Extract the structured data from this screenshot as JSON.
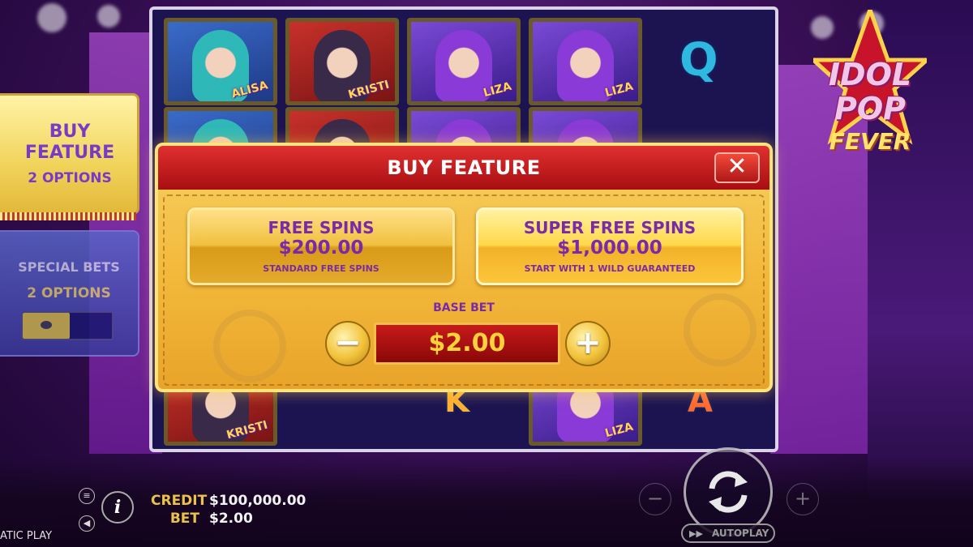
{
  "game": {
    "logo_line1": "IDOL",
    "logo_line2": "POP",
    "logo_line3": "FEVER"
  },
  "reels": {
    "symbol_names": [
      "ALISA",
      "KRISTI",
      "LIZA",
      "LIZA",
      "KRISTI",
      "LIZA"
    ]
  },
  "side_panels": {
    "buy_feature_title": "BUY FEATURE",
    "buy_feature_options": "2 OPTIONS",
    "special_bets_title": "SPECIAL BETS",
    "special_bets_options": "2 OPTIONS"
  },
  "modal": {
    "title": "BUY FEATURE",
    "close_label": "✕",
    "options": [
      {
        "name": "FREE SPINS",
        "price": "$200.00",
        "desc": "STANDARD FREE SPINS"
      },
      {
        "name": "SUPER FREE SPINS",
        "price": "$1,000.00",
        "desc": "START WITH 1 WILD GUARANTEED"
      }
    ],
    "base_bet_label": "BASE BET",
    "base_bet_value": "$2.00",
    "minus_label": "−",
    "plus_label": "+"
  },
  "bottom": {
    "credit_label": "CREDIT",
    "credit_value": "$100,000.00",
    "bet_label": "BET",
    "bet_value": "$2.00",
    "brand_text": "ATIC PLAY",
    "autoplay_label": "AUTOPLAY",
    "ctrl_minus": "−",
    "ctrl_plus": "+",
    "menu_icon": "≡",
    "sound_icon": "◀",
    "info_icon": "i"
  },
  "colors": {
    "modal_header": "#c8181c",
    "modal_body": "#f2b83a",
    "option_text": "#7a2aa8",
    "bet_display": "#a80e12",
    "bet_text": "#ffd23a"
  }
}
